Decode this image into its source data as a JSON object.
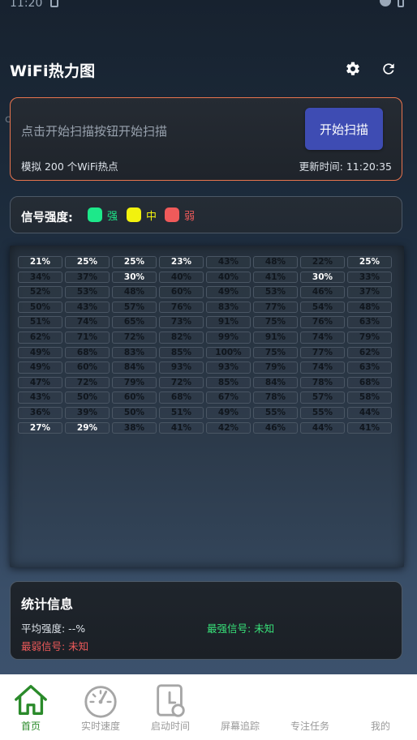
{
  "status": {
    "time": "11:20"
  },
  "app": {
    "title": "WiFi热力图",
    "overlay_id": "cdf754"
  },
  "scan": {
    "prompt": "点击开始扫描按钮开始扫描",
    "button_label": "开始扫描",
    "sub_label": "模拟 200 个WiFi热点",
    "update_label": "更新时间: 11:20:35"
  },
  "legend": {
    "title": "信号强度:",
    "items": [
      {
        "label": "强",
        "color": "#1de88a"
      },
      {
        "label": "中",
        "color": "#f2f20e"
      },
      {
        "label": "弱",
        "color": "#ef5a5a"
      }
    ]
  },
  "heatmap": {
    "cells": [
      [
        "21%",
        "25%",
        "25%",
        "23%",
        "43%",
        "48%",
        "22%",
        "25%"
      ],
      [
        "34%",
        "37%",
        "30%",
        "40%",
        "40%",
        "41%",
        "30%",
        "33%"
      ],
      [
        "52%",
        "53%",
        "48%",
        "60%",
        "49%",
        "53%",
        "46%",
        "37%"
      ],
      [
        "50%",
        "43%",
        "57%",
        "76%",
        "83%",
        "77%",
        "54%",
        "48%"
      ],
      [
        "51%",
        "74%",
        "65%",
        "73%",
        "91%",
        "75%",
        "76%",
        "63%"
      ],
      [
        "62%",
        "71%",
        "72%",
        "82%",
        "99%",
        "91%",
        "74%",
        "79%"
      ],
      [
        "49%",
        "68%",
        "83%",
        "85%",
        "100%",
        "75%",
        "77%",
        "62%"
      ],
      [
        "49%",
        "60%",
        "84%",
        "93%",
        "93%",
        "79%",
        "74%",
        "63%"
      ],
      [
        "47%",
        "72%",
        "79%",
        "72%",
        "85%",
        "84%",
        "78%",
        "68%"
      ],
      [
        "43%",
        "50%",
        "60%",
        "68%",
        "67%",
        "78%",
        "57%",
        "58%"
      ],
      [
        "36%",
        "39%",
        "50%",
        "51%",
        "49%",
        "55%",
        "55%",
        "44%"
      ],
      [
        "27%",
        "29%",
        "38%",
        "41%",
        "42%",
        "46%",
        "44%",
        "41%"
      ]
    ],
    "visible_cells": [
      [
        0,
        0
      ],
      [
        0,
        1
      ],
      [
        0,
        2
      ],
      [
        0,
        3
      ],
      [
        0,
        7
      ],
      [
        1,
        2
      ],
      [
        1,
        6
      ],
      [
        11,
        0
      ],
      [
        11,
        1
      ]
    ]
  },
  "stats": {
    "title": "统计信息",
    "avg_label": "平均强度: --%",
    "strongest_label": "最强信号: 未知",
    "weakest_label": "最弱信号: 未知"
  },
  "nav": {
    "items": [
      {
        "label": "首页",
        "icon": "home-icon",
        "active": true
      },
      {
        "label": "实时速度",
        "icon": "speedometer-icon",
        "active": false
      },
      {
        "label": "启动时间",
        "icon": "startup-time-icon",
        "active": false
      },
      {
        "label": "屏幕追踪",
        "icon": "screen-track-icon",
        "active": false
      },
      {
        "label": "专注任务",
        "icon": "focus-task-icon",
        "active": false
      },
      {
        "label": "我的",
        "icon": "profile-icon",
        "active": false
      }
    ],
    "active_color": "#2a8a2a",
    "inactive_color": "#9a9a9a"
  }
}
